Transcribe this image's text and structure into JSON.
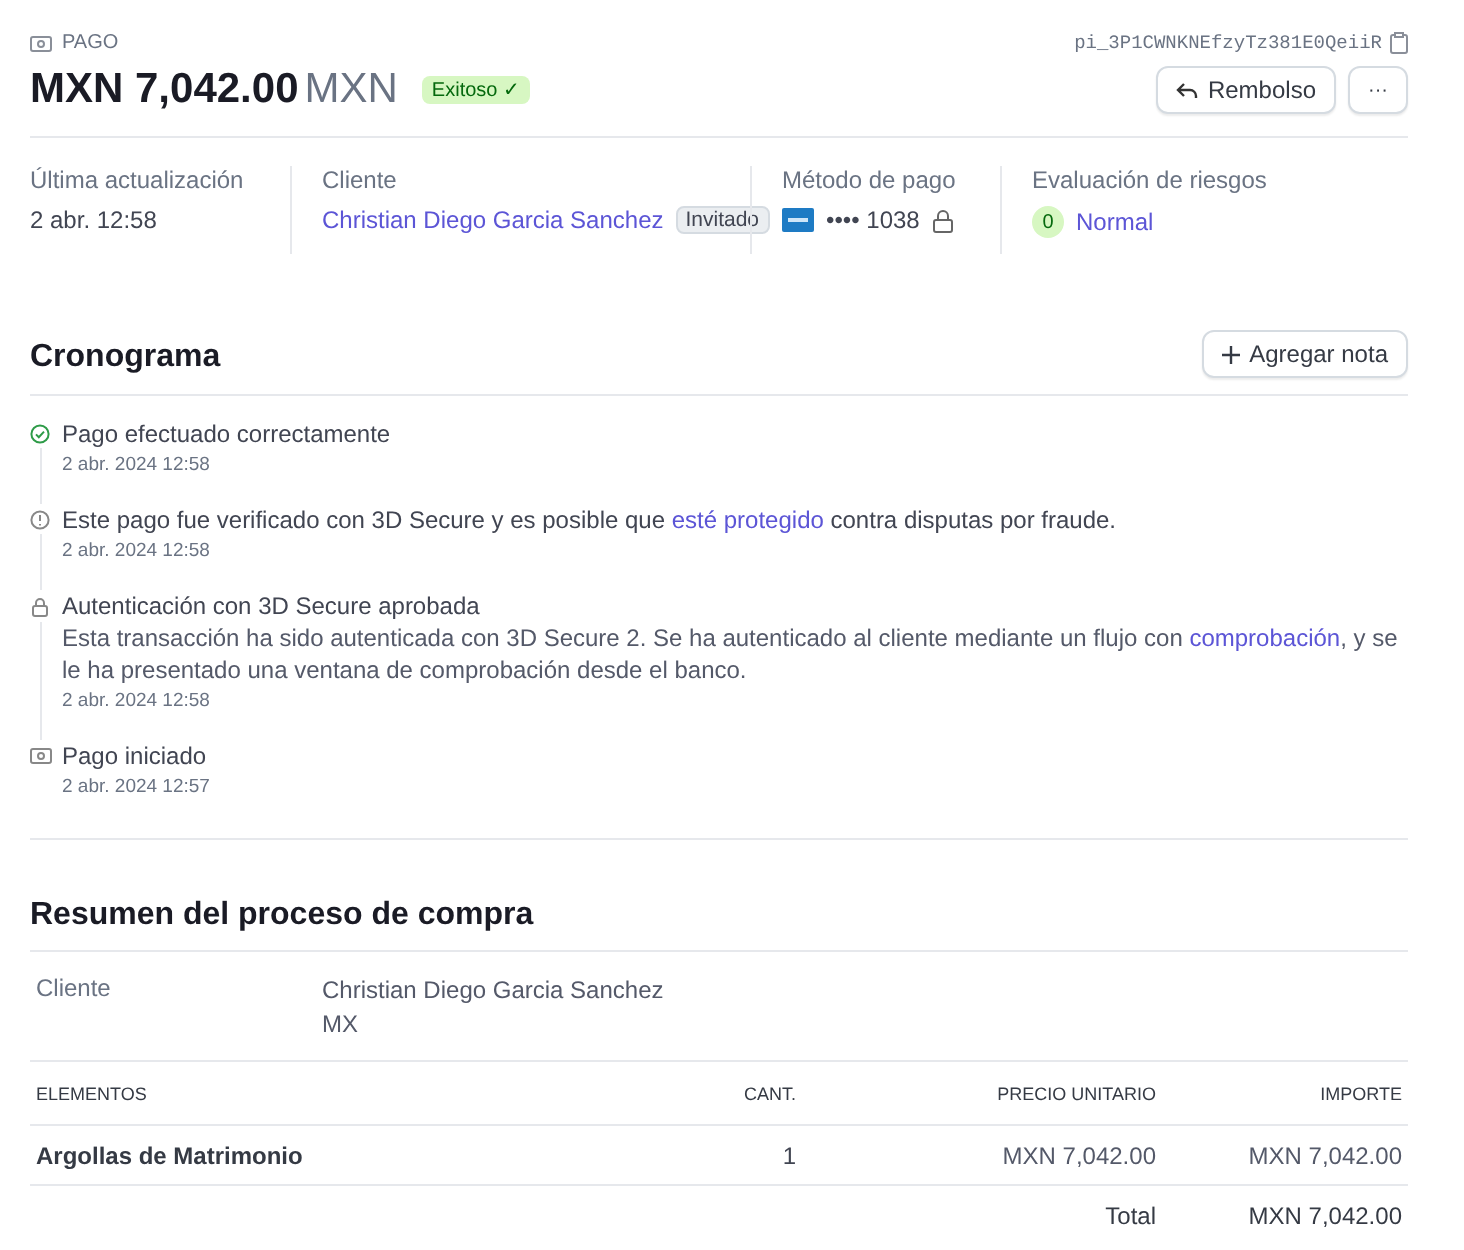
{
  "header": {
    "label": "PAGO",
    "payment_id": "pi_3P1CWNKNEfzyTz381E0QeiiR",
    "amount": "MXN 7,042.00",
    "currency": "MXN",
    "status": "Exitoso",
    "status_icon": "✓",
    "buttons": [
      {
        "label": "Rembolso",
        "kind": "refund"
      },
      {
        "label": "···",
        "kind": "more"
      }
    ]
  },
  "summary": [
    {
      "label": "Última actualización",
      "kind": "text",
      "value": "2 abr. 12:58"
    },
    {
      "label": "Cliente",
      "kind": "customer",
      "value": "Christian Diego Garcia Sanchez",
      "badge": "Invitado"
    },
    {
      "label": "Método de pago",
      "kind": "card",
      "value": "•••• 1038"
    },
    {
      "label": "Evaluación de riesgos",
      "kind": "risk",
      "score": "0",
      "value": "Normal"
    }
  ],
  "timeline": {
    "title": "Cronograma",
    "add_button": "Agregar nota",
    "events": [
      {
        "kind": "success",
        "title": [
          {
            "text": "Pago efectuado correctamente",
            "link": false
          }
        ],
        "time": "2 abr. 2024 12:58"
      },
      {
        "kind": "info",
        "title": [
          {
            "text": "Este pago fue verificado con 3D Secure y es posible que ",
            "link": false
          },
          {
            "text": "esté protegido",
            "link": true
          },
          {
            "text": " contra disputas por fraude.",
            "link": false
          }
        ],
        "time": "2 abr. 2024 12:58"
      },
      {
        "kind": "lock",
        "title": [
          {
            "text": "Autenticación con 3D Secure aprobada",
            "link": false
          }
        ],
        "description": [
          {
            "text": "Esta transacción ha sido autenticada con 3D Secure 2. Se ha autenticado al cliente mediante un flujo con ",
            "link": false
          },
          {
            "text": "comprobación",
            "link": true
          },
          {
            "text": ", y se le ha presentado una ventana de comprobación desde el banco.",
            "link": false
          }
        ],
        "time": "2 abr. 2024 12:58"
      },
      {
        "kind": "payment",
        "title": [
          {
            "text": "Pago iniciado",
            "link": false
          }
        ],
        "time": "2 abr. 2024 12:57"
      }
    ]
  },
  "checkout": {
    "title": "Resumen del proceso de compra",
    "customer_label": "Cliente",
    "customer_lines": [
      "Christian Diego Garcia Sanchez",
      "MX"
    ],
    "columns": [
      "ELEMENTOS",
      "CANT.",
      "PRECIO UNITARIO",
      "IMPORTE"
    ],
    "rows": [
      [
        "Argollas de Matrimonio",
        "1",
        "MXN 7,042.00",
        "MXN 7,042.00"
      ]
    ],
    "total_label": "Total",
    "total_value": "MXN 7,042.00"
  }
}
